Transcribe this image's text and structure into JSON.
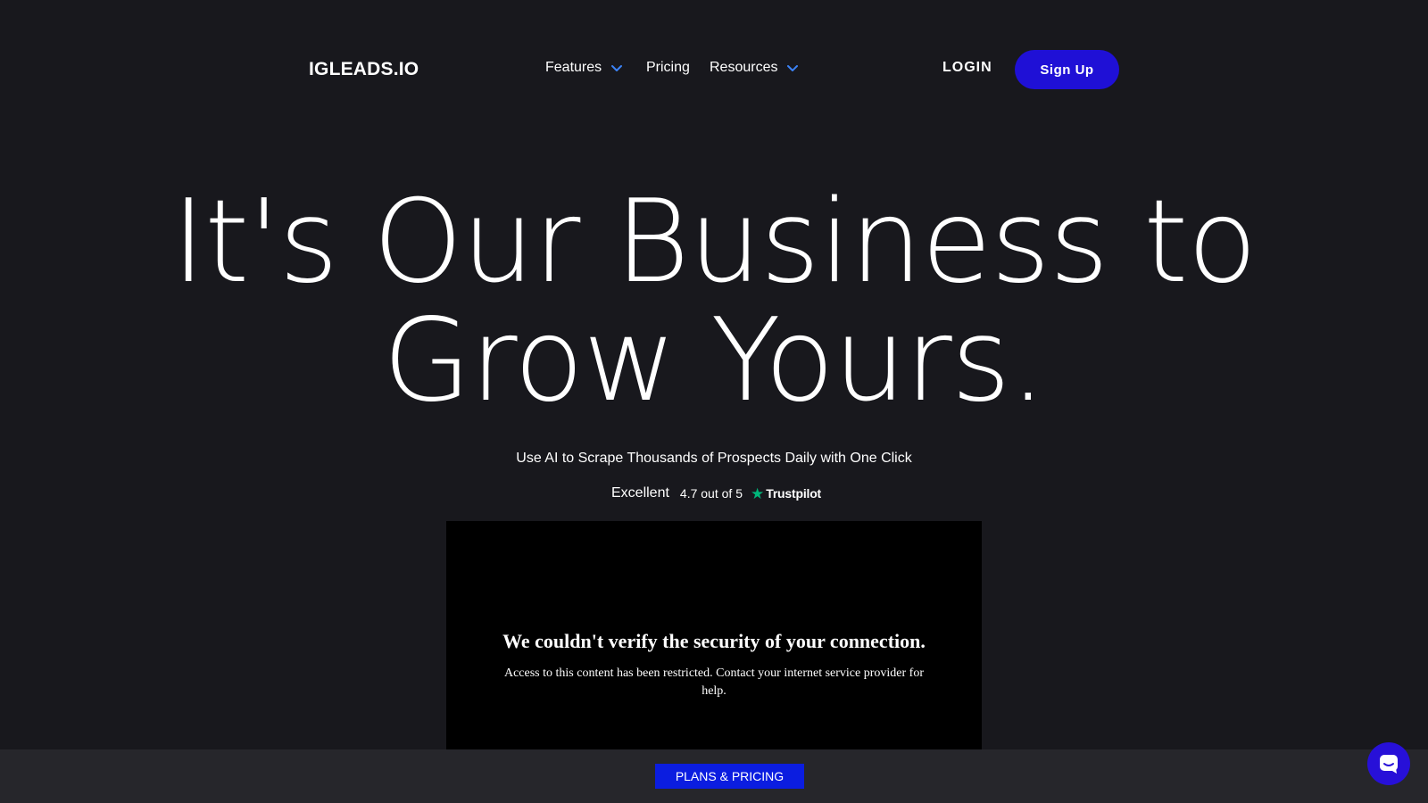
{
  "nav": {
    "logo": "IGLEADS.IO",
    "items": [
      {
        "label": "Features",
        "has_dropdown": true
      },
      {
        "label": "Pricing",
        "has_dropdown": false
      },
      {
        "label": "Resources",
        "has_dropdown": true
      }
    ],
    "login_label": "LOGIN",
    "signup_label": "Sign Up",
    "accent_color": "#1f10d6",
    "chevron_color": "#3b82f6"
  },
  "hero": {
    "line1": "It's Our Business to",
    "line2": "Grow Yours.",
    "subtitle": "Use AI to Scrape Thousands of Prospects Daily with One Click"
  },
  "rating": {
    "label": "Excellent",
    "score_text": "4.7 out of 5",
    "provider": "Trustpilot",
    "provider_icon": "star-icon",
    "provider_color": "#00b67a"
  },
  "blocked_frame": {
    "title": "We couldn't verify the security of your connection.",
    "message": "Access to this content has been restricted. Contact your internet service provider for help."
  },
  "bottom_bar": {
    "plans_label": "PLANS & PRICING",
    "chat_icon": "chat-icon"
  }
}
